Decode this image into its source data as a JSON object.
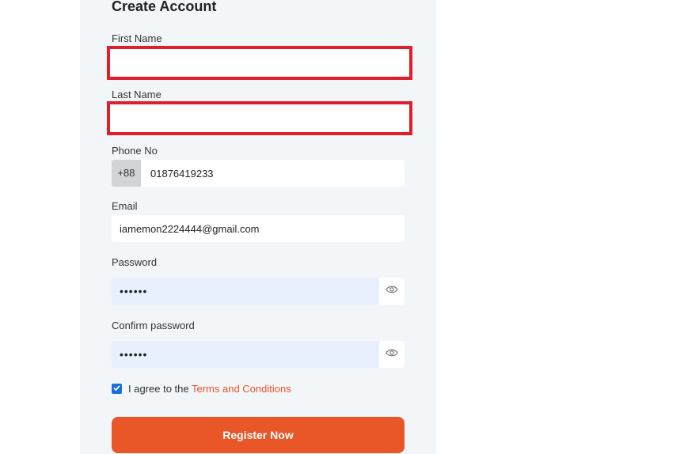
{
  "form": {
    "title": "Create Account",
    "first_name": {
      "label": "First Name",
      "value": ""
    },
    "last_name": {
      "label": "Last Name",
      "value": ""
    },
    "phone": {
      "label": "Phone No",
      "prefix": "+88",
      "value": "01876419233"
    },
    "email": {
      "label": "Email",
      "value": "iamemon2224444@gmail.com"
    },
    "password": {
      "label": "Password",
      "value": "••••••"
    },
    "confirm_password": {
      "label": "Confirm password",
      "value": "••••••"
    },
    "agree": {
      "text": "I agree to the ",
      "link": "Terms and Conditions",
      "checked": true
    },
    "submit_label": "Register Now"
  },
  "icons": {
    "password_toggle": "eye-icon",
    "confirm_password_toggle": "eye-icon",
    "checkbox": "check-icon"
  },
  "colors": {
    "accent": "#e95628",
    "link": "#e7532a",
    "error_border": "#e01e2c",
    "autofill_bg": "#e8f0fe",
    "panel_bg": "#f3f6f8",
    "checkbox": "#1a6fe0"
  }
}
